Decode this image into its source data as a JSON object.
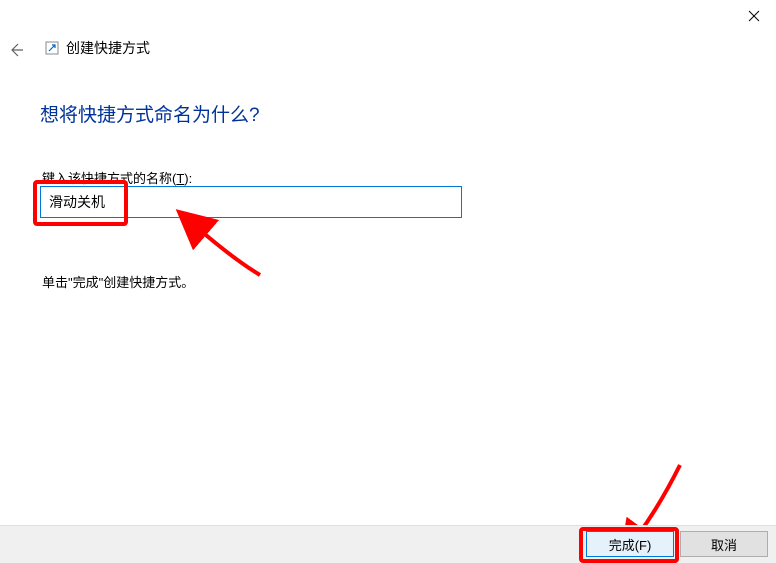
{
  "header": {
    "title": "创建快捷方式"
  },
  "main": {
    "heading": "想将快捷方式命名为什么?",
    "field_label_prefix": "键入该快捷方式的名称(",
    "field_label_key": "T",
    "field_label_suffix": "):",
    "input_value": "滑动关机",
    "instruction": "单击\"完成\"创建快捷方式。"
  },
  "footer": {
    "finish_label": "完成(F)",
    "cancel_label": "取消"
  }
}
